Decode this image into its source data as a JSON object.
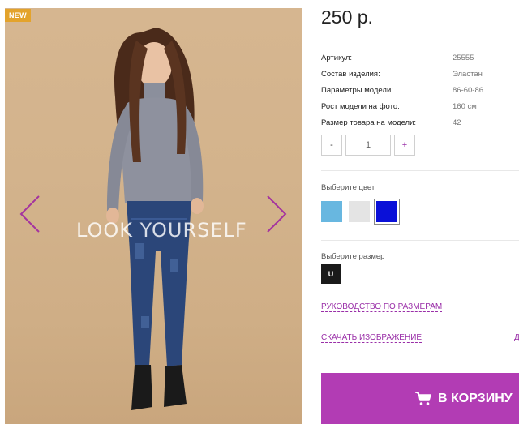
{
  "product": {
    "badge": "NEW",
    "watermark": "LOOK YOURSELF",
    "price": "250 р.",
    "specs": [
      {
        "label": "Артикул:",
        "value": "25555"
      },
      {
        "label": "Состав изделия:",
        "value": "Эластан"
      },
      {
        "label": "Параметры модели:",
        "value": "86-60-86"
      },
      {
        "label": "Рост модели на фото:",
        "value": "160 см"
      },
      {
        "label": "Размер товара на модели:",
        "value": "42"
      }
    ],
    "quantity": {
      "minus": "-",
      "value": "1",
      "plus": "+"
    },
    "color_label": "Выберите цвет",
    "colors": [
      "#68b7e0",
      "#e4e4e4",
      "#0a10d8"
    ],
    "selected_color_index": 2,
    "size_label": "Выберите размер",
    "sizes": [
      "U"
    ],
    "size_guide_link": "РУКОВОДСТВО ПО РАЗМЕРАМ",
    "download_link": "СКАЧАТЬ ИЗОБРАЖЕНИЕ",
    "edge_link": "Д",
    "cart_button": "В КОРЗИНУ"
  },
  "colors": {
    "accent": "#b23cb4",
    "link": "#9a2fa8",
    "badge": "#e3a32c"
  }
}
